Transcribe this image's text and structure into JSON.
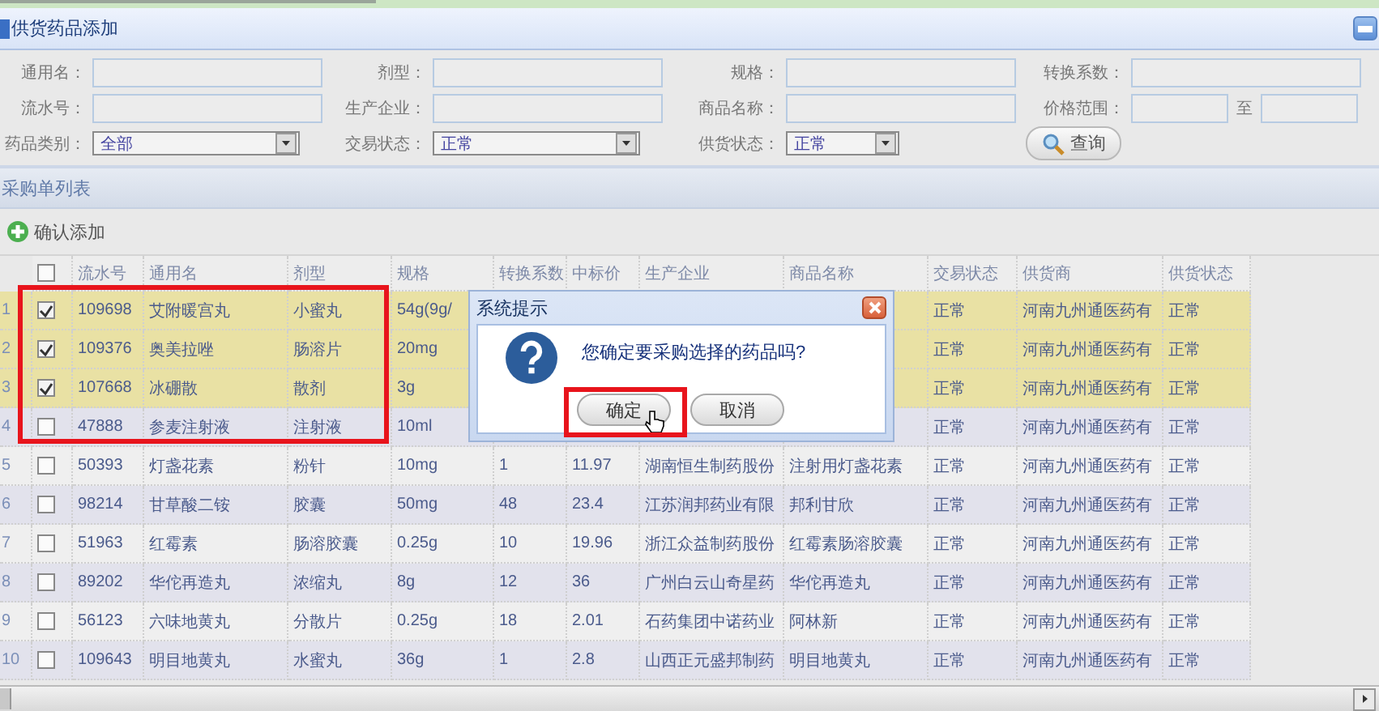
{
  "panel": {
    "title": "供货药品添加"
  },
  "filters": [
    {
      "label": "通用名：",
      "kind": "text"
    },
    {
      "label": "剂型：",
      "kind": "text"
    },
    {
      "label": "规格：",
      "kind": "text"
    },
    {
      "label": "转换系数：",
      "kind": "text"
    },
    {
      "label": "流水号：",
      "kind": "text"
    },
    {
      "label": "生产企业：",
      "kind": "text"
    },
    {
      "label": "商品名称：",
      "kind": "text"
    },
    {
      "label": "价格范围：",
      "kind": "range",
      "separator": "至"
    },
    {
      "label": "药品类别：",
      "kind": "select",
      "value": "全部"
    },
    {
      "label": "交易状态：",
      "kind": "select",
      "value": "正常"
    },
    {
      "label": "供货状态：",
      "kind": "select",
      "value": "正常"
    },
    {
      "kind": "button",
      "label": "查询"
    }
  ],
  "list": {
    "title": "采购单列表",
    "toolbar_button": "确认添加"
  },
  "columns": [
    "流水号",
    "通用名",
    "剂型",
    "规格",
    "转换系数",
    "中标价",
    "生产企业",
    "商品名称",
    "交易状态",
    "供货商",
    "供货状态"
  ],
  "header_checked": false,
  "rows": [
    {
      "num": "1",
      "checked": true,
      "selected": true,
      "cells": [
        "109698",
        "艾附暖宫丸",
        "小蜜丸",
        "54g(9g/",
        "",
        "",
        "",
        "",
        "正常",
        "河南九州通医药有",
        "正常"
      ]
    },
    {
      "num": "2",
      "checked": true,
      "selected": true,
      "cells": [
        "109376",
        "奥美拉唑",
        "肠溶片",
        "20mg",
        "",
        "",
        "",
        "",
        "正常",
        "河南九州通医药有",
        "正常"
      ]
    },
    {
      "num": "3",
      "checked": true,
      "selected": true,
      "cells": [
        "107668",
        "冰硼散",
        "散剂",
        "3g",
        "",
        "",
        "",
        "",
        "正常",
        "河南九州通医药有",
        "正常"
      ]
    },
    {
      "num": "4",
      "checked": false,
      "selected": false,
      "cells": [
        "47888",
        "参麦注射液",
        "注射液",
        "10ml",
        "",
        "",
        "",
        "",
        "正常",
        "河南九州通医药有",
        "正常"
      ]
    },
    {
      "num": "5",
      "checked": false,
      "selected": false,
      "cells": [
        "50393",
        "灯盏花素",
        "粉针",
        "10mg",
        "1",
        "11.97",
        "湖南恒生制药股份",
        "注射用灯盏花素",
        "正常",
        "河南九州通医药有",
        "正常"
      ]
    },
    {
      "num": "6",
      "checked": false,
      "selected": false,
      "cells": [
        "98214",
        "甘草酸二铵",
        "胶囊",
        "50mg",
        "48",
        "23.4",
        "江苏润邦药业有限",
        "邦利甘欣",
        "正常",
        "河南九州通医药有",
        "正常"
      ]
    },
    {
      "num": "7",
      "checked": false,
      "selected": false,
      "cells": [
        "51963",
        "红霉素",
        "肠溶胶囊",
        "0.25g",
        "10",
        "19.96",
        "浙江众益制药股份",
        "红霉素肠溶胶囊",
        "正常",
        "河南九州通医药有",
        "正常"
      ]
    },
    {
      "num": "8",
      "checked": false,
      "selected": false,
      "cells": [
        "89202",
        "华佗再造丸",
        "浓缩丸",
        "8g",
        "12",
        "36",
        "广州白云山奇星药",
        "华佗再造丸",
        "正常",
        "河南九州通医药有",
        "正常"
      ]
    },
    {
      "num": "9",
      "checked": false,
      "selected": false,
      "cells": [
        "56123",
        "六味地黄丸",
        "分散片",
        "0.25g",
        "18",
        "2.01",
        "石药集团中诺药业",
        "阿林新",
        "正常",
        "河南九州通医药有",
        "正常"
      ]
    },
    {
      "num": "10",
      "checked": false,
      "selected": false,
      "cells": [
        "109643",
        "明目地黄丸",
        "水蜜丸",
        "36g",
        "1",
        "2.8",
        "山西正元盛邦制药",
        "明目地黄丸",
        "正常",
        "河南九州通医药有",
        "正常"
      ]
    }
  ],
  "dialog": {
    "title": "系统提示",
    "message": "您确定要采购选择的药品吗?",
    "buttons": [
      "确定",
      "取消"
    ]
  }
}
